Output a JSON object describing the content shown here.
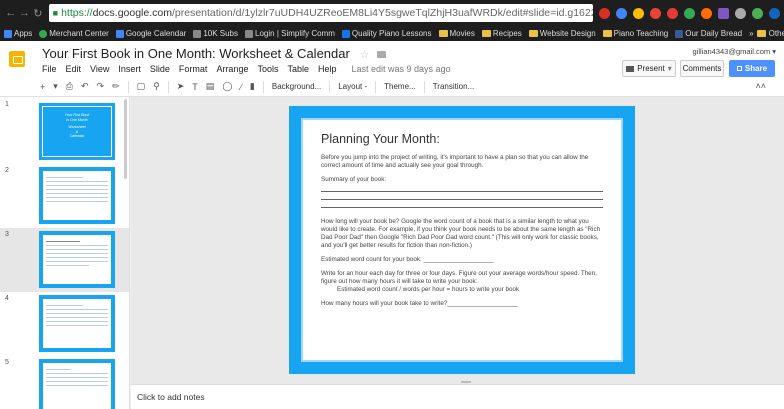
{
  "browser": {
    "url_prefix": "https://",
    "url_domain": "docs.google.com",
    "url_path": "/presentation/d/1ylzlr7uUDH4UZReoEM8Li4Y5sgweTqlZhjH3uafWRDk/edit#slide=id.g1622efc",
    "bookmarks": [
      {
        "label": "Apps",
        "color": "#4285f4"
      },
      {
        "label": "Merchant Center",
        "color": "#34a853"
      },
      {
        "label": "Google Calendar",
        "color": "#4285f4"
      },
      {
        "label": "10K Subs",
        "color": "#888888"
      },
      {
        "label": "Login | Simplify Comm",
        "color": "#888888"
      },
      {
        "label": "Quality Piano Lessons",
        "color": "#1a73e8"
      },
      {
        "label": "Movies",
        "folder": true
      },
      {
        "label": "Recipes",
        "folder": true
      },
      {
        "label": "Website Design",
        "folder": true
      },
      {
        "label": "Piano Teaching",
        "folder": true
      },
      {
        "label": "Our Daily Bread",
        "color": "#3b5998"
      }
    ],
    "other_bookmarks": "Other bookmar",
    "overflow": "»"
  },
  "doc": {
    "title": "Your First Book in One Month: Worksheet & Calendar",
    "user_email": "gillian4343@gmail.com",
    "menu": [
      "File",
      "Edit",
      "View",
      "Insert",
      "Slide",
      "Format",
      "Arrange",
      "Tools",
      "Table",
      "Help"
    ],
    "last_edit": "Last edit was 9 days ago",
    "present_label": "Present",
    "comments_label": "Comments",
    "share_label": "Share",
    "accent": "#4d90fe"
  },
  "toolbar": {
    "background": "Background...",
    "layout": "Layout -",
    "theme": "Theme...",
    "transition": "Transition..."
  },
  "filmstrip": {
    "slide_numbers": [
      "1",
      "2",
      "3",
      "4",
      "5"
    ],
    "title_thumb": [
      "Your First Book",
      "in One Month",
      "Worksheet",
      "&",
      "Calendar"
    ],
    "selected": 3,
    "accent": "#17a4f0"
  },
  "slide": {
    "heading": "Planning Your Month:",
    "p1": "Before you jump into the project of writing, it's important to have a plan so that you can allow the correct amount of time and actually see your goal through.",
    "p2": "Summary of your book:",
    "p3": "How long will your book be? Google the word count of a book that is a similar length to what you would like to create. For example, if you think your book needs to be about the same length as \"Rich Dad Poor Dad\" then Google \"Rich Dad Poor Dad word count.\" (This will only work for classic books, and you'll get better results for fiction than non-fiction.)",
    "p4": "Estimated word count for your book: ____________________",
    "p5": "Write for an hour each day for three or four days. Figure out your average words/hour speed. Then, figure out how many hours it will take to write your book:",
    "p6": "Estimated word count / words per hour = hours to write your book",
    "p7": "How many hours will your book take to write?____________________"
  },
  "notes": {
    "placeholder": "Click to add notes"
  }
}
